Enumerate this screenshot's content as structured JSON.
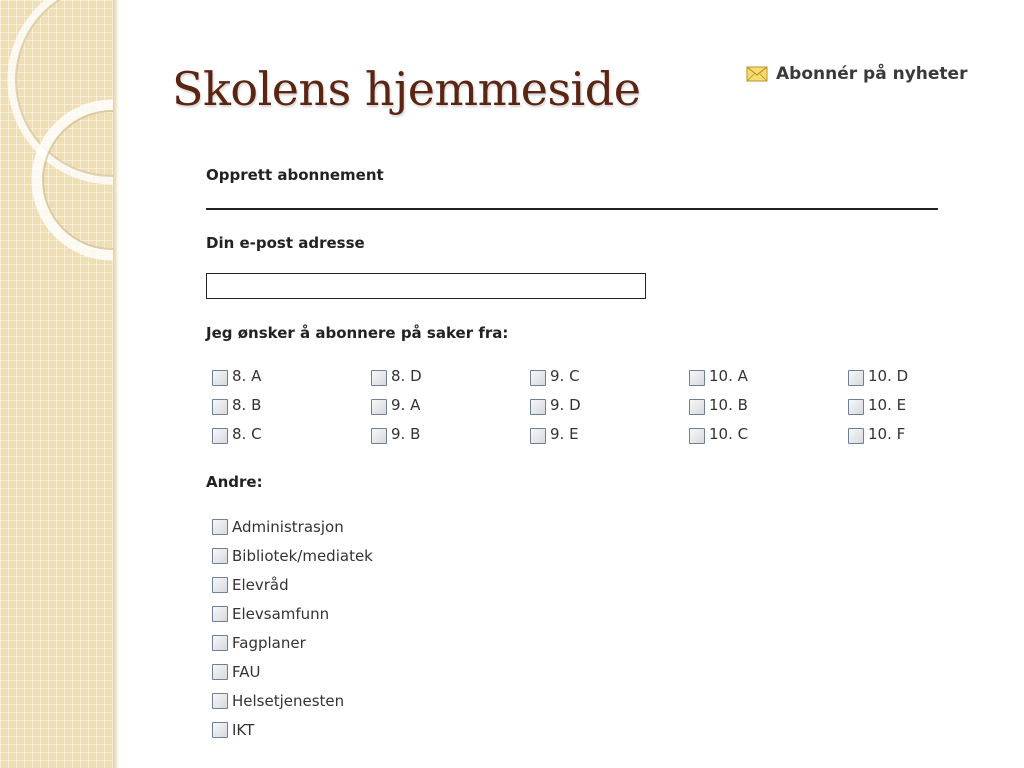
{
  "slide": {
    "title": "Skolens hjemmeside"
  },
  "header": {
    "subscribe_icon": "envelope-icon",
    "subscribe_label": "Abonnér på nyheter"
  },
  "form": {
    "heading": "Opprett abonnement",
    "email_label": "Din e-post adresse",
    "email_value": "",
    "email_placeholder": "",
    "classes_label": "Jeg ønsker å abonnere på saker fra:",
    "class_columns": [
      [
        "8. A",
        "8. B",
        "8. C"
      ],
      [
        "8. D",
        "9. A",
        "9. B"
      ],
      [
        "9. C",
        "9. D",
        "9. E"
      ],
      [
        "10. A",
        "10. B",
        "10. C"
      ],
      [
        "10. D",
        "10. E",
        "10. F"
      ]
    ],
    "others_label": "Andre:",
    "others": [
      "Administrasjon",
      "Bibliotek/mediatek",
      "Elevråd",
      "Elevsamfunn",
      "Fagplaner",
      "FAU",
      "Helsetjenesten",
      "IKT"
    ]
  },
  "colors": {
    "title": "#5a2513",
    "strip": "#efdeb4"
  }
}
